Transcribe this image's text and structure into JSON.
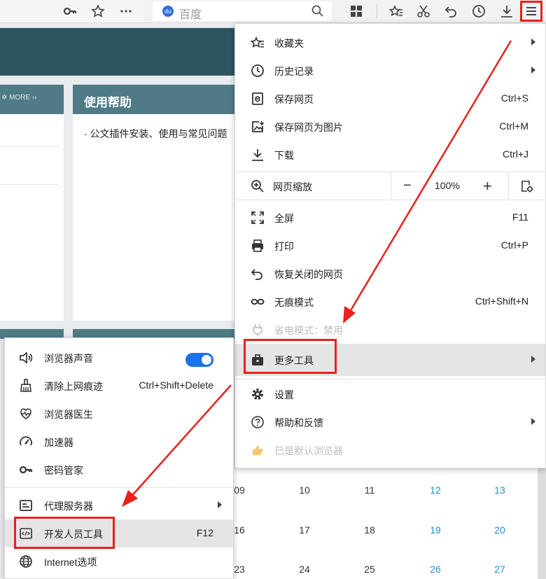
{
  "toolbar": {
    "search_engine_label": "百度",
    "icons": [
      "key-icon",
      "star-icon",
      "more-icon",
      "grid-icon",
      "favorites-icon",
      "scissors-icon",
      "undo-icon",
      "history-icon",
      "download-icon",
      "menu-icon"
    ]
  },
  "page": {
    "more_label": "MORE",
    "help_title": "使用帮助",
    "help_item": "· 公文插件安装、使用与常见问题"
  },
  "main_menu": {
    "favorites": {
      "label": "收藏夹"
    },
    "history": {
      "label": "历史记录"
    },
    "save_page": {
      "label": "保存网页",
      "shortcut": "Ctrl+S"
    },
    "save_as_image": {
      "label": "保存网页为图片",
      "shortcut": "Ctrl+M"
    },
    "downloads": {
      "label": "下载",
      "shortcut": "Ctrl+J"
    },
    "zoom": {
      "label": "网页缩放",
      "minus": "−",
      "value": "100%",
      "plus": "+"
    },
    "fullscreen": {
      "label": "全屏",
      "shortcut": "F11"
    },
    "print": {
      "label": "打印",
      "shortcut": "Ctrl+P"
    },
    "restore_closed": {
      "label": "恢复关闭的网页"
    },
    "incognito": {
      "label": "无痕模式",
      "shortcut": "Ctrl+Shift+N"
    },
    "power_save": {
      "label": "省电模式：禁用"
    },
    "more_tools": {
      "label": "更多工具"
    },
    "settings": {
      "label": "设置"
    },
    "help_feedback": {
      "label": "帮助和反馈"
    },
    "default_browser": {
      "label": "已是默认浏览器"
    }
  },
  "sub_menu": {
    "browser_sound": {
      "label": "浏览器声音",
      "enabled": true
    },
    "clear_traces": {
      "label": "清除上网痕迹",
      "shortcut": "Ctrl+Shift+Delete"
    },
    "browser_doctor": {
      "label": "浏览器医生"
    },
    "accelerator": {
      "label": "加速器"
    },
    "password_manager": {
      "label": "密码管家"
    },
    "proxy_server": {
      "label": "代理服务器"
    },
    "dev_tools": {
      "label": "开发人员工具",
      "shortcut": "F12"
    },
    "internet_options": {
      "label": "Internet选项"
    }
  },
  "calendar": {
    "row1": [
      "09",
      "10",
      "11",
      "12",
      "13"
    ],
    "row2": [
      "16",
      "17",
      "18",
      "19",
      "20"
    ],
    "row3": [
      "23",
      "24",
      "25",
      "26",
      "27"
    ]
  },
  "colors": {
    "accent_red": "#e8211b",
    "toggle_blue": "#1a73e8",
    "weekend_blue": "#1a8fd6",
    "panel_teal": "#4e7b86"
  }
}
